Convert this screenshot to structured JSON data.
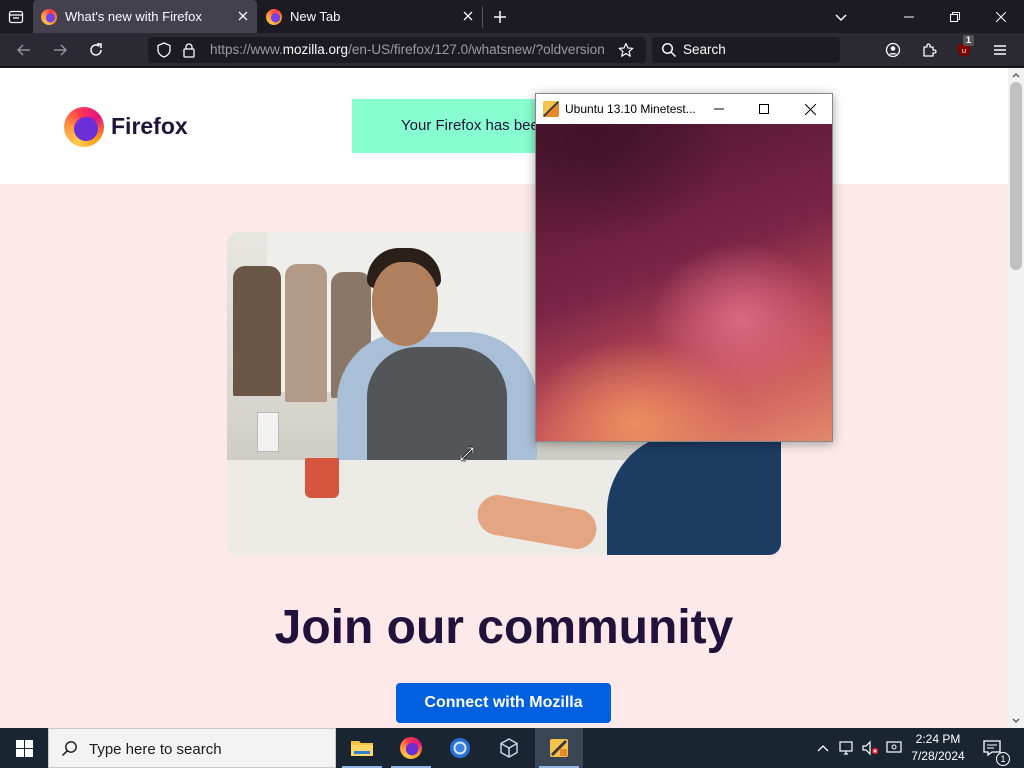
{
  "tabs": [
    {
      "title": "What's new with Firefox",
      "active": true
    },
    {
      "title": "New Tab",
      "active": false
    }
  ],
  "urlbar": {
    "url_prefix": "https://www.",
    "url_domain": "mozilla.org",
    "url_suffix": "/en-US/firefox/127.0/whatsnew/?oldversion"
  },
  "searchbar": {
    "placeholder": "Search"
  },
  "extension": {
    "badge": "1"
  },
  "page": {
    "brand": "Firefox",
    "update_banner": "Your Firefox has bee",
    "heading": "Join our community",
    "cta_label": "Connect with Mozilla"
  },
  "app_window": {
    "title": "Ubuntu 13.10 Minetest..."
  },
  "taskbar": {
    "search_placeholder": "Type here to search",
    "clock_time": "2:24 PM",
    "clock_date": "7/28/2024",
    "notification_count": "1"
  },
  "colors": {
    "browser_chrome": "#1c1b22",
    "page_background": "#fde9e9",
    "cta_button": "#0060df",
    "banner_accent": "#88ffd1",
    "heading_text": "#20123a"
  }
}
